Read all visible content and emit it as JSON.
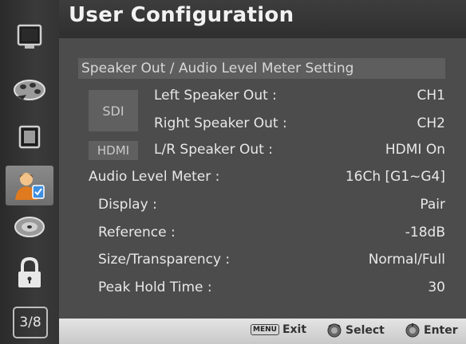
{
  "header": {
    "title": "User Configuration"
  },
  "sidebar": {
    "items": [
      {
        "icon": "monitor-icon"
      },
      {
        "icon": "color-palette-icon"
      },
      {
        "icon": "picture-icon"
      },
      {
        "icon": "user-config-icon",
        "active": true
      },
      {
        "icon": "disc-icon"
      },
      {
        "icon": "lock-icon"
      }
    ],
    "page_indicator": "3/8"
  },
  "section": {
    "title": "Speaker Out / Audio Level Meter Setting"
  },
  "input_boxes": {
    "sdi": "SDI",
    "hdmi": "HDMI"
  },
  "settings": {
    "left_speaker_out": {
      "label": "Left Speaker Out :",
      "value": "CH1"
    },
    "right_speaker_out": {
      "label": "Right Speaker Out :",
      "value": "CH2"
    },
    "lr_speaker_out": {
      "label": "L/R Speaker Out :",
      "value": "HDMI On"
    },
    "audio_level_meter": {
      "label": "Audio Level Meter :",
      "value": "16Ch [G1~G4]"
    },
    "display": {
      "label": "Display :",
      "value": "Pair"
    },
    "reference": {
      "label": "Reference :",
      "value": "-18dB"
    },
    "size_transparency": {
      "label": "Size/Transparency :",
      "value": "Normal/Full"
    },
    "peak_hold_time": {
      "label": "Peak Hold Time :",
      "value": "30"
    }
  },
  "footer": {
    "menu_key": "MENU",
    "exit_label": "Exit",
    "select_label": "Select",
    "enter_label": "Enter"
  },
  "colors": {
    "panel_bg": "#4c4c4c",
    "sidebar_bg": "#333333",
    "footer_bg": "#d6d6d6",
    "text": "#e8e8e8"
  }
}
